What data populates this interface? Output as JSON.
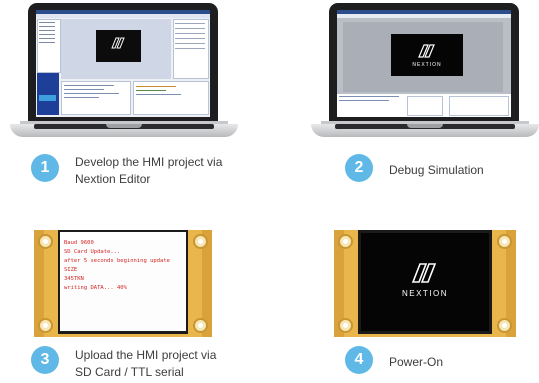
{
  "steps": [
    {
      "number": "1",
      "line1": "Develop the HMI project via",
      "line2": "Nextion Editor"
    },
    {
      "number": "2",
      "line1": "Debug Simulation",
      "line2": ""
    },
    {
      "number": "3",
      "line1": "Upload the HMI project via",
      "line2": "SD Card / TTL serial"
    },
    {
      "number": "4",
      "line1": "Power-On",
      "line2": ""
    }
  ],
  "logo_text": "NEXTION",
  "boot_screen": {
    "lines": [
      "Baud      9600",
      "SD Card Update...",
      "after 5 seconds beginning    update",
      "SIZE",
      "          345TKN",
      "writing DATA...   40%"
    ]
  },
  "colors": {
    "accent": "#5fb8e6",
    "pcb": "#e8b64a",
    "boot_text": "#d42424"
  }
}
